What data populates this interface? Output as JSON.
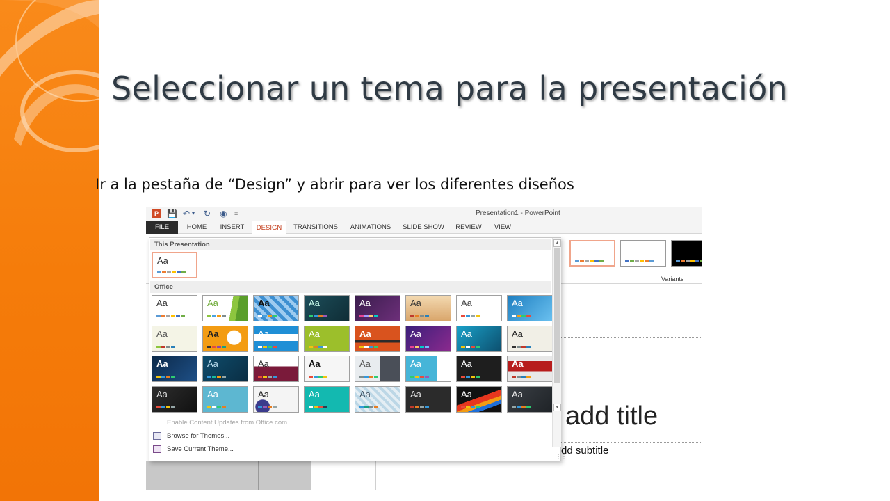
{
  "slide": {
    "title": "Seleccionar un tema para la presentación",
    "body": "Ir a la pestaña de “Design” y abrir para ver los diferentes diseños"
  },
  "app": {
    "icon_label": "P",
    "window_title": "Presentation1 - PowerPoint",
    "qat_more": "=",
    "tabs": [
      {
        "label": "FILE"
      },
      {
        "label": "HOME"
      },
      {
        "label": "INSERT"
      },
      {
        "label": "DESIGN"
      },
      {
        "label": "TRANSITIONS"
      },
      {
        "label": "ANIMATIONS"
      },
      {
        "label": "SLIDE SHOW"
      },
      {
        "label": "REVIEW"
      },
      {
        "label": "VIEW"
      }
    ],
    "active_tab": "DESIGN",
    "variants_label": "Variants"
  },
  "gallery": {
    "section_this": "This Presentation",
    "section_office": "Office",
    "thumb_text": "Aa",
    "menu": {
      "enable_updates": "Enable Content Updates from Office.com...",
      "browse": "Browse for Themes...",
      "save": "Save Current Theme..."
    }
  },
  "slide_placeholders": {
    "title": "add title",
    "subtitle": "dd subtitle"
  },
  "colors": {
    "accent_orange": "#f57c0a",
    "design_tab_text": "#c43e1c",
    "selected_border": "#f0a58b"
  }
}
